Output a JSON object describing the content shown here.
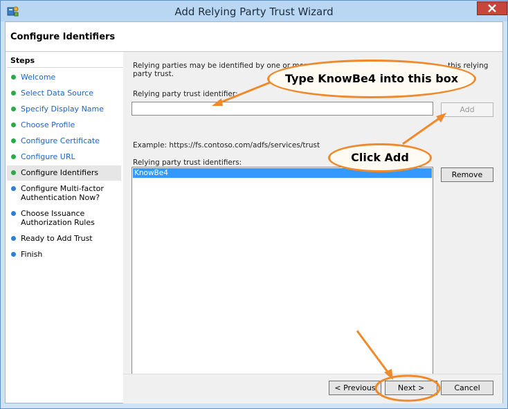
{
  "window": {
    "title": "Add Relying Party Trust Wizard"
  },
  "page": {
    "title": "Configure Identifiers"
  },
  "steps": {
    "heading": "Steps",
    "items": [
      {
        "label": "Welcome",
        "state": "done"
      },
      {
        "label": "Select Data Source",
        "state": "done"
      },
      {
        "label": "Specify Display Name",
        "state": "done"
      },
      {
        "label": "Choose Profile",
        "state": "done"
      },
      {
        "label": "Configure Certificate",
        "state": "done"
      },
      {
        "label": "Configure URL",
        "state": "done"
      },
      {
        "label": "Configure Identifiers",
        "state": "current"
      },
      {
        "label": "Configure Multi-factor Authentication Now?",
        "state": "pending"
      },
      {
        "label": "Choose Issuance Authorization Rules",
        "state": "pending"
      },
      {
        "label": "Ready to Add Trust",
        "state": "pending"
      },
      {
        "label": "Finish",
        "state": "pending"
      }
    ]
  },
  "content": {
    "description_left": "Relying parties may be identified by one or more u",
    "description_right": "this relying",
    "description_line2": "party trust.",
    "identifier_label": "Relying party trust identifier:",
    "identifier_value": "",
    "add_label": "Add",
    "example": "Example: https://fs.contoso.com/adfs/services/trust",
    "list_label": "Relying party trust identifiers:",
    "identifiers": [
      "KnowBe4"
    ],
    "remove_label": "Remove"
  },
  "footer": {
    "previous_label": "< Previous",
    "next_label": "Next >",
    "cancel_label": "Cancel"
  },
  "annotations": {
    "callout_type": "Type KnowBe4 into this box",
    "callout_add": "Click Add"
  },
  "colors": {
    "accent_orange": "#ee8a2c",
    "link_blue": "#1c64c4",
    "done_green": "#2fa84a",
    "pending_blue": "#2f7fd1",
    "selection_blue": "#3399ff"
  }
}
